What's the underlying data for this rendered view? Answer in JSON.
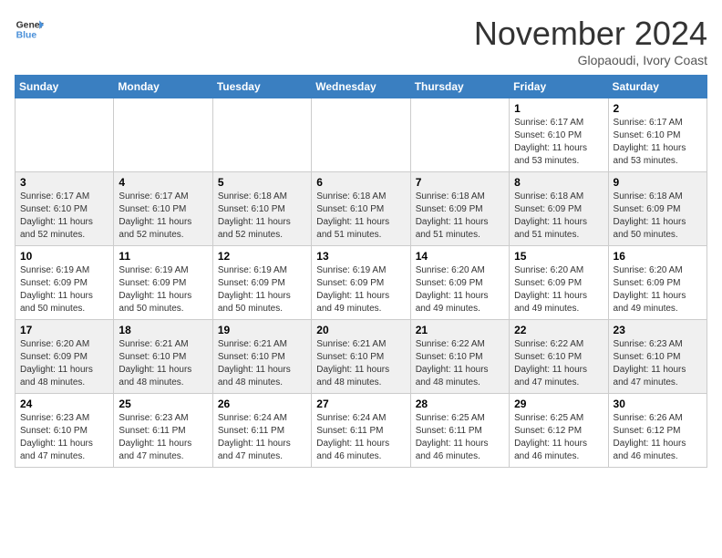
{
  "header": {
    "logo_line1": "General",
    "logo_line2": "Blue",
    "month": "November 2024",
    "location": "Glopaoudi, Ivory Coast"
  },
  "weekdays": [
    "Sunday",
    "Monday",
    "Tuesday",
    "Wednesday",
    "Thursday",
    "Friday",
    "Saturday"
  ],
  "weeks": [
    [
      {
        "day": "",
        "info": ""
      },
      {
        "day": "",
        "info": ""
      },
      {
        "day": "",
        "info": ""
      },
      {
        "day": "",
        "info": ""
      },
      {
        "day": "",
        "info": ""
      },
      {
        "day": "1",
        "info": "Sunrise: 6:17 AM\nSunset: 6:10 PM\nDaylight: 11 hours\nand 53 minutes."
      },
      {
        "day": "2",
        "info": "Sunrise: 6:17 AM\nSunset: 6:10 PM\nDaylight: 11 hours\nand 53 minutes."
      }
    ],
    [
      {
        "day": "3",
        "info": "Sunrise: 6:17 AM\nSunset: 6:10 PM\nDaylight: 11 hours\nand 52 minutes."
      },
      {
        "day": "4",
        "info": "Sunrise: 6:17 AM\nSunset: 6:10 PM\nDaylight: 11 hours\nand 52 minutes."
      },
      {
        "day": "5",
        "info": "Sunrise: 6:18 AM\nSunset: 6:10 PM\nDaylight: 11 hours\nand 52 minutes."
      },
      {
        "day": "6",
        "info": "Sunrise: 6:18 AM\nSunset: 6:10 PM\nDaylight: 11 hours\nand 51 minutes."
      },
      {
        "day": "7",
        "info": "Sunrise: 6:18 AM\nSunset: 6:09 PM\nDaylight: 11 hours\nand 51 minutes."
      },
      {
        "day": "8",
        "info": "Sunrise: 6:18 AM\nSunset: 6:09 PM\nDaylight: 11 hours\nand 51 minutes."
      },
      {
        "day": "9",
        "info": "Sunrise: 6:18 AM\nSunset: 6:09 PM\nDaylight: 11 hours\nand 50 minutes."
      }
    ],
    [
      {
        "day": "10",
        "info": "Sunrise: 6:19 AM\nSunset: 6:09 PM\nDaylight: 11 hours\nand 50 minutes."
      },
      {
        "day": "11",
        "info": "Sunrise: 6:19 AM\nSunset: 6:09 PM\nDaylight: 11 hours\nand 50 minutes."
      },
      {
        "day": "12",
        "info": "Sunrise: 6:19 AM\nSunset: 6:09 PM\nDaylight: 11 hours\nand 50 minutes."
      },
      {
        "day": "13",
        "info": "Sunrise: 6:19 AM\nSunset: 6:09 PM\nDaylight: 11 hours\nand 49 minutes."
      },
      {
        "day": "14",
        "info": "Sunrise: 6:20 AM\nSunset: 6:09 PM\nDaylight: 11 hours\nand 49 minutes."
      },
      {
        "day": "15",
        "info": "Sunrise: 6:20 AM\nSunset: 6:09 PM\nDaylight: 11 hours\nand 49 minutes."
      },
      {
        "day": "16",
        "info": "Sunrise: 6:20 AM\nSunset: 6:09 PM\nDaylight: 11 hours\nand 49 minutes."
      }
    ],
    [
      {
        "day": "17",
        "info": "Sunrise: 6:20 AM\nSunset: 6:09 PM\nDaylight: 11 hours\nand 48 minutes."
      },
      {
        "day": "18",
        "info": "Sunrise: 6:21 AM\nSunset: 6:10 PM\nDaylight: 11 hours\nand 48 minutes."
      },
      {
        "day": "19",
        "info": "Sunrise: 6:21 AM\nSunset: 6:10 PM\nDaylight: 11 hours\nand 48 minutes."
      },
      {
        "day": "20",
        "info": "Sunrise: 6:21 AM\nSunset: 6:10 PM\nDaylight: 11 hours\nand 48 minutes."
      },
      {
        "day": "21",
        "info": "Sunrise: 6:22 AM\nSunset: 6:10 PM\nDaylight: 11 hours\nand 48 minutes."
      },
      {
        "day": "22",
        "info": "Sunrise: 6:22 AM\nSunset: 6:10 PM\nDaylight: 11 hours\nand 47 minutes."
      },
      {
        "day": "23",
        "info": "Sunrise: 6:23 AM\nSunset: 6:10 PM\nDaylight: 11 hours\nand 47 minutes."
      }
    ],
    [
      {
        "day": "24",
        "info": "Sunrise: 6:23 AM\nSunset: 6:10 PM\nDaylight: 11 hours\nand 47 minutes."
      },
      {
        "day": "25",
        "info": "Sunrise: 6:23 AM\nSunset: 6:11 PM\nDaylight: 11 hours\nand 47 minutes."
      },
      {
        "day": "26",
        "info": "Sunrise: 6:24 AM\nSunset: 6:11 PM\nDaylight: 11 hours\nand 47 minutes."
      },
      {
        "day": "27",
        "info": "Sunrise: 6:24 AM\nSunset: 6:11 PM\nDaylight: 11 hours\nand 46 minutes."
      },
      {
        "day": "28",
        "info": "Sunrise: 6:25 AM\nSunset: 6:11 PM\nDaylight: 11 hours\nand 46 minutes."
      },
      {
        "day": "29",
        "info": "Sunrise: 6:25 AM\nSunset: 6:12 PM\nDaylight: 11 hours\nand 46 minutes."
      },
      {
        "day": "30",
        "info": "Sunrise: 6:26 AM\nSunset: 6:12 PM\nDaylight: 11 hours\nand 46 minutes."
      }
    ]
  ]
}
